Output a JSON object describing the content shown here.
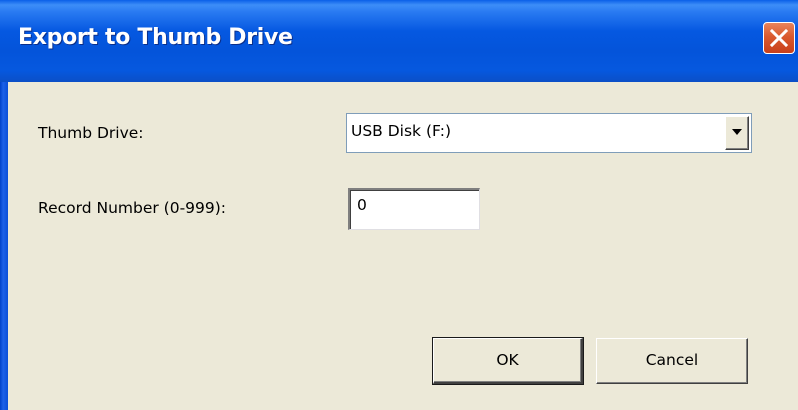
{
  "window": {
    "title": "Export to Thumb Drive",
    "close_icon": "close-icon"
  },
  "form": {
    "thumb_drive_label": "Thumb Drive:",
    "thumb_drive_value": "USB Disk (F:)",
    "dropdown_icon": "chevron-down-icon",
    "record_number_label": "Record Number (0-999):",
    "record_number_value": "0"
  },
  "buttons": {
    "ok_label": "OK",
    "cancel_label": "Cancel"
  },
  "colors": {
    "titlebar": "#0558E1",
    "title_text": "#FFFFFF",
    "client_background": "#ECE9D8",
    "close_button": "#DA5A2E",
    "field_border": "#7F9DB9"
  }
}
